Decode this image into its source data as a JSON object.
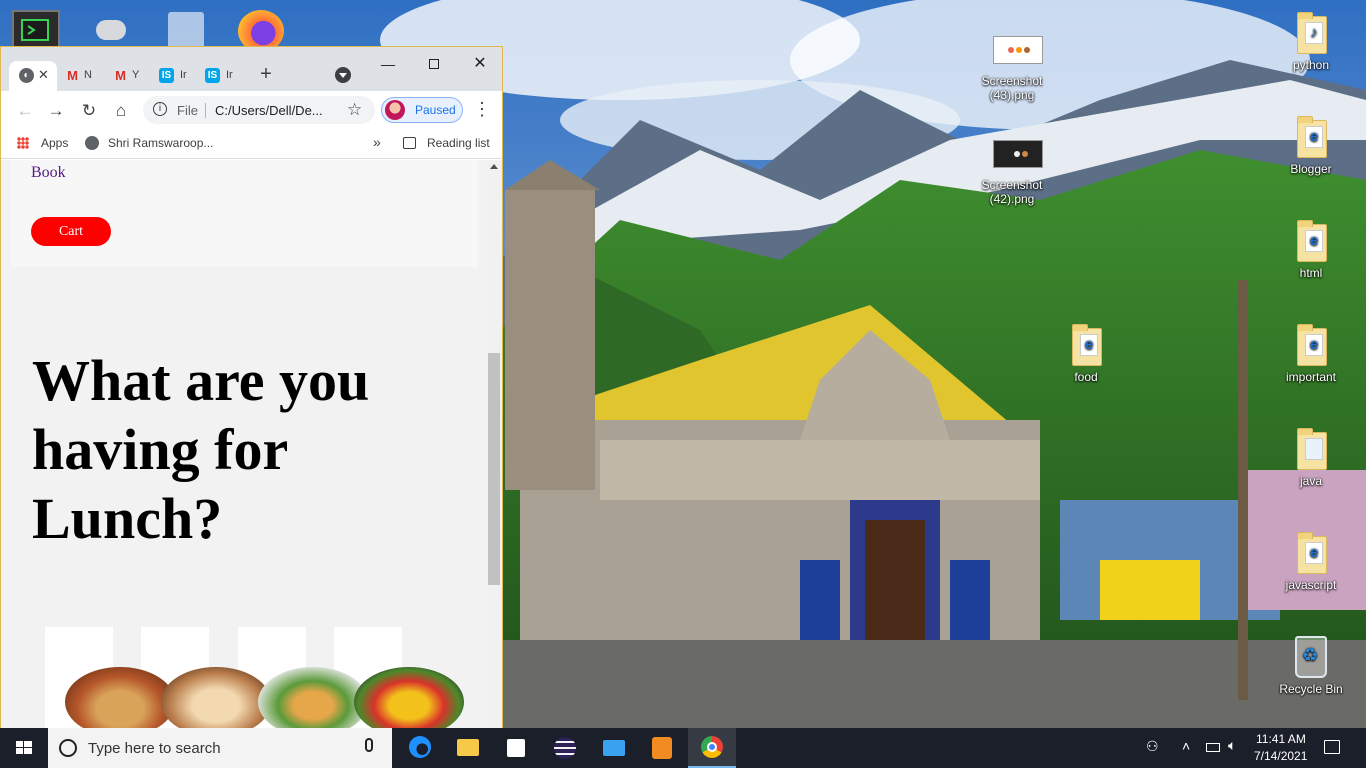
{
  "desktop": {
    "icons": [
      {
        "label": "Screenshot (43).png",
        "line1": "Screenshot",
        "line2": "(43).png"
      },
      {
        "label": "Screenshot (42).png",
        "line1": "Screenshot",
        "line2": "(42).png"
      },
      {
        "label": "python"
      },
      {
        "label": "Blogger"
      },
      {
        "label": "html"
      },
      {
        "label": "food"
      },
      {
        "label": "important"
      },
      {
        "label": "java"
      },
      {
        "label": "javascript"
      },
      {
        "label": "Recycle Bin"
      }
    ]
  },
  "browser": {
    "tabs": [
      {
        "label": "",
        "icon": "globe-icon"
      },
      {
        "label": "N",
        "icon": "gmail-icon"
      },
      {
        "label": "Y",
        "icon": "gmail-icon"
      },
      {
        "label": "Ir",
        "icon": "internshala-icon"
      },
      {
        "label": "Ir",
        "icon": "internshala-icon"
      }
    ],
    "new_tab": "+",
    "file_label": "File",
    "url": "C:/Users/Dell/De...",
    "profile_status": "Paused",
    "bookmarks": {
      "apps": "Apps",
      "item1": "Shri Ramswaroop...",
      "more": "»",
      "reading_list": "Reading list"
    }
  },
  "page": {
    "book_link": "Book",
    "cart_button": "Cart",
    "headline": "What are you having for Lunch?"
  },
  "taskbar": {
    "search_placeholder": "Type here to search",
    "time": "11:41 AM",
    "date": "7/14/2021"
  },
  "colors": {
    "cart_red": "#ff0000",
    "link_purple": "#551a8b",
    "taskbar": "#1b1f2a",
    "window_border": "#e0b84d"
  }
}
